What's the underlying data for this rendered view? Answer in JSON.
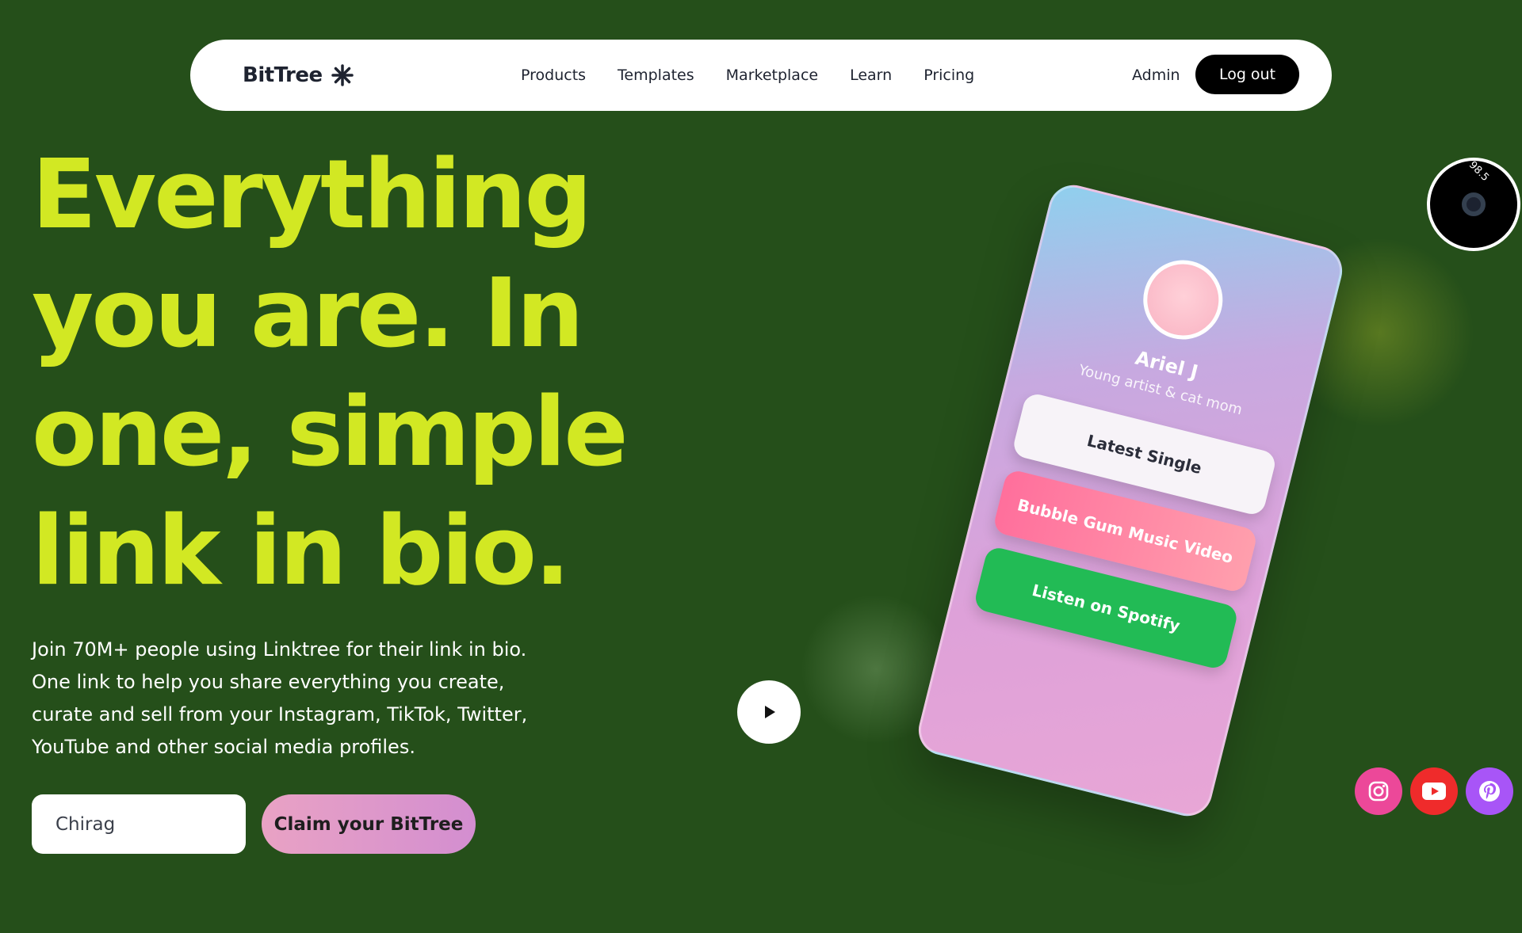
{
  "nav": {
    "brand": "BitTree",
    "brand_icon": "asterisk-icon",
    "menu": [
      {
        "label": "Products"
      },
      {
        "label": "Templates"
      },
      {
        "label": "Marketplace"
      },
      {
        "label": "Learn"
      },
      {
        "label": "Pricing"
      }
    ],
    "admin_label": "Admin",
    "logout_label": "Log out"
  },
  "hero": {
    "headline_lines": [
      "Everything",
      "you are. In",
      "one, simple",
      "link in bio."
    ],
    "description": "Join 70M+ people using Linktree for their link in bio. One link to help you share everything you create, curate and sell from your Instagram, TikTok, Twitter, YouTube and other social media profiles.",
    "input_value": "Chirag",
    "claim_label": "Claim your BitTree"
  },
  "phone": {
    "name": "Ariel J",
    "bio": "Young artist & cat mom",
    "links": [
      {
        "label": "Latest Single"
      },
      {
        "label": "Bubble Gum Music Video"
      },
      {
        "label": "Listen on Spotify"
      }
    ]
  },
  "vinyl": {
    "label": "98.5"
  },
  "social": [
    {
      "icon": "instagram-icon",
      "color": "#ec4899"
    },
    {
      "icon": "youtube-icon",
      "color": "#ef2b2b"
    },
    {
      "icon": "pinterest-icon",
      "color": "#a855f7"
    }
  ],
  "colors": {
    "background": "#254f1a",
    "headline": "#d2e823",
    "spotify_green": "#22bb55"
  }
}
